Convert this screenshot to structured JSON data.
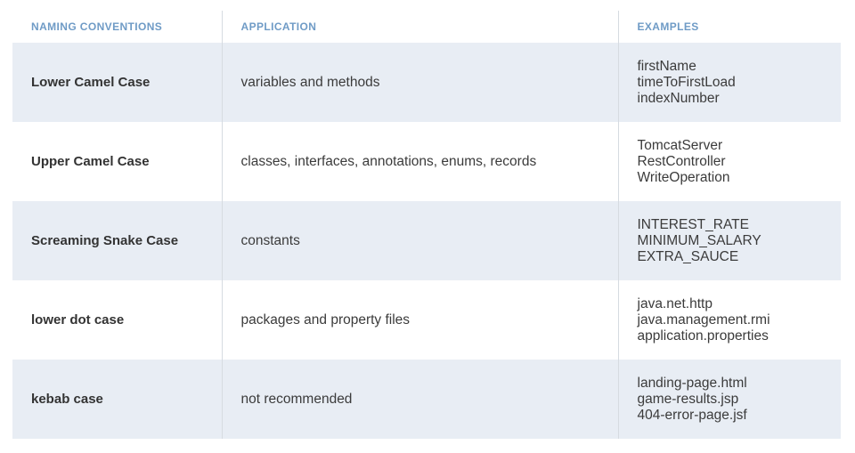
{
  "headers": {
    "col1": "NAMING CONVENTIONS",
    "col2": "APPLICATION",
    "col3": "EXAMPLES"
  },
  "rows": [
    {
      "name": "Lower Camel Case",
      "application": "variables and methods",
      "examples": [
        "firstName",
        "timeToFirstLoad",
        "indexNumber"
      ]
    },
    {
      "name": "Upper Camel Case",
      "application": "classes, interfaces, annotations, enums, records",
      "examples": [
        "TomcatServer",
        "RestController",
        "WriteOperation"
      ]
    },
    {
      "name": "Screaming Snake Case",
      "application": "constants",
      "examples": [
        "INTEREST_RATE",
        "MINIMUM_SALARY",
        "EXTRA_SAUCE"
      ]
    },
    {
      "name": "lower dot case",
      "application": "packages and property files",
      "examples": [
        "java.net.http",
        "java.management.rmi",
        "application.properties"
      ]
    },
    {
      "name": "kebab case",
      "application": "not recommended",
      "examples": [
        "landing-page.html",
        "game-results.jsp",
        "404-error-page.jsf"
      ]
    }
  ],
  "colors": {
    "header_text": "#6f9bc6",
    "shaded_row": "#e8edf4",
    "body_text": "#3b3b3b",
    "divider": "#d6dbe1"
  }
}
